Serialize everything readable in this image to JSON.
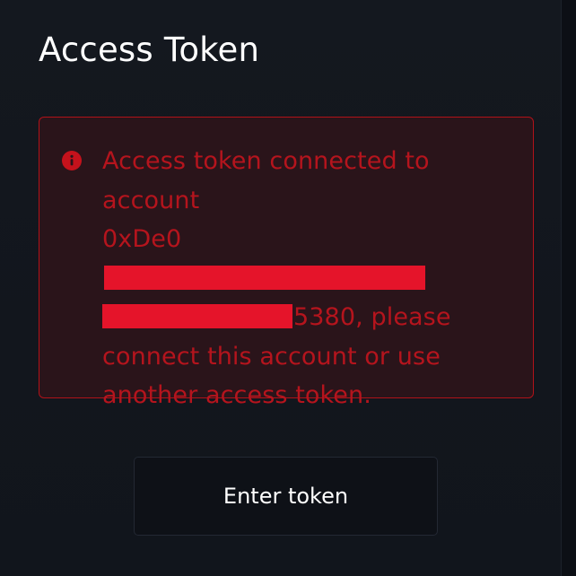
{
  "title": "Access Token",
  "error": {
    "icon": "info-icon",
    "line1": "Access token connected to",
    "line2": "account",
    "address_prefix": "0xDe0",
    "address_suffix_and_text": "5380, please",
    "line5": "connect this account or use",
    "line6": "another access token.",
    "colors": {
      "text": "#b5141d",
      "border": "#b01219",
      "background": "#2a141a",
      "redaction": "#e5142a"
    }
  },
  "button": {
    "label": "Enter token"
  }
}
